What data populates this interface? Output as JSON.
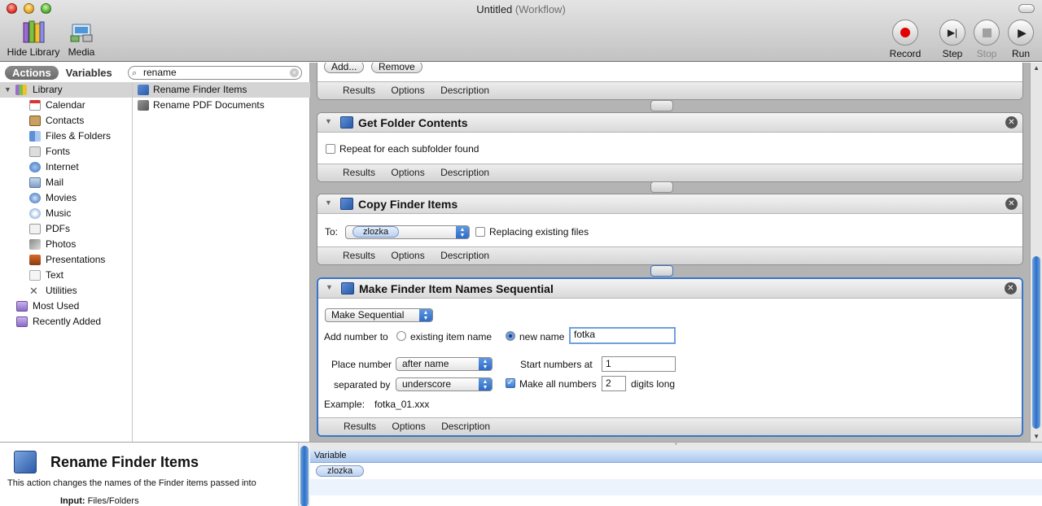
{
  "window": {
    "title": "Untitled",
    "title_suffix": "(Workflow)"
  },
  "toolbar": {
    "hide_library": "Hide Library",
    "media": "Media",
    "record": "Record",
    "step": "Step",
    "stop": "Stop",
    "run": "Run"
  },
  "library": {
    "tabs": [
      "Actions",
      "Variables"
    ],
    "search_value": "rename",
    "categories": [
      "Library",
      "Calendar",
      "Contacts",
      "Files & Folders",
      "Fonts",
      "Internet",
      "Mail",
      "Movies",
      "Music",
      "PDFs",
      "Photos",
      "Presentations",
      "Text",
      "Utilities",
      "Most Used",
      "Recently Added"
    ],
    "results": [
      "Rename Finder Items",
      "Rename PDF Documents"
    ]
  },
  "description": {
    "title": "Rename Finder Items",
    "text": "This action changes the names of the Finder items passed into",
    "input_label": "Input:",
    "input_value": "Files/Folders"
  },
  "workflow": {
    "top_card": {
      "add": "Add...",
      "remove": "Remove"
    },
    "footer": {
      "results": "Results",
      "options": "Options",
      "description": "Description"
    },
    "get_folder": {
      "title": "Get Folder Contents",
      "repeat": "Repeat for each subfolder found"
    },
    "copy": {
      "title": "Copy Finder Items",
      "to_label": "To:",
      "to_value": "zlozka",
      "replacing": "Replacing existing files"
    },
    "sequential": {
      "title": "Make Finder Item Names Sequential",
      "mode": "Make Sequential",
      "add_number_to": "Add number to",
      "existing": "existing item name",
      "new_name": "new name",
      "new_name_value": "fotka",
      "place_number": "Place number",
      "place_value": "after name",
      "separated_by": "separated by",
      "separator_value": "underscore",
      "start_numbers_at": "Start numbers at",
      "start_value": "1",
      "make_all": "Make all numbers",
      "digits_value": "2",
      "digits_long": "digits long",
      "example_label": "Example:",
      "example_value": "fotka_01.xxx"
    }
  },
  "variables": {
    "header": "Variable",
    "items": [
      "zlozka"
    ]
  },
  "colors": {
    "accent": "#3a75c7",
    "record": "#e00000"
  }
}
